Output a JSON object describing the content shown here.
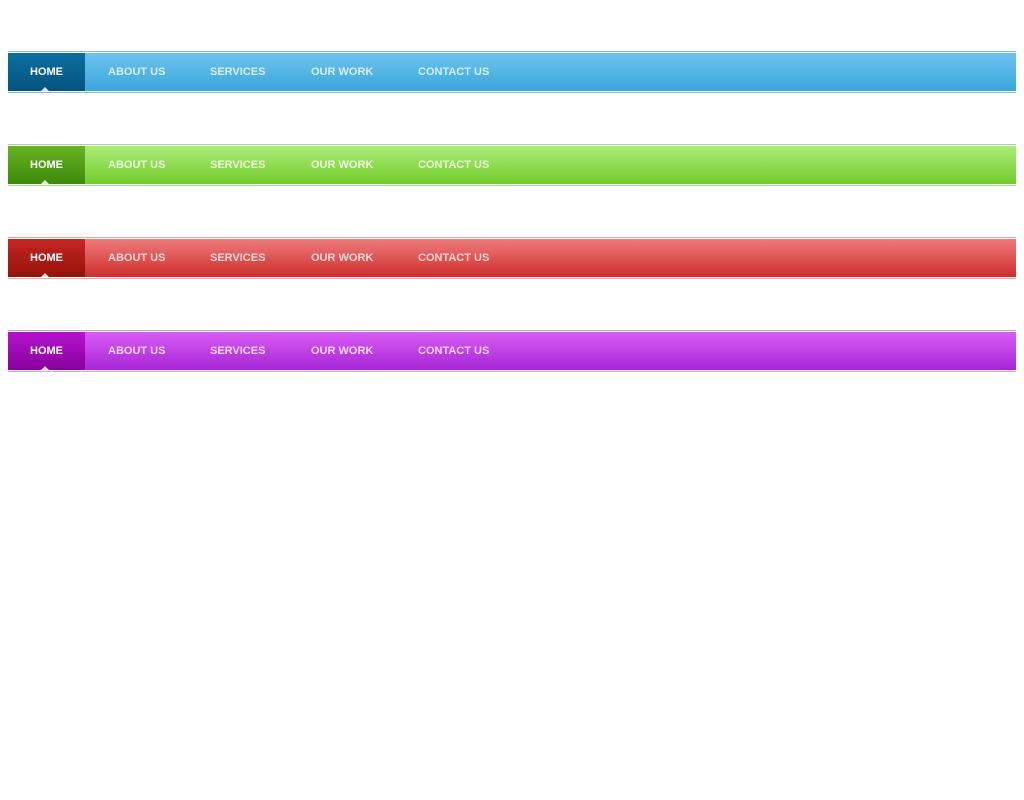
{
  "menus": [
    {
      "theme": "blue",
      "accent": "#3aa6dd",
      "active_color": "#04547f",
      "items": [
        {
          "label": "HOME",
          "active": true
        },
        {
          "label": "ABOUT US",
          "active": false
        },
        {
          "label": "SERVICES",
          "active": false
        },
        {
          "label": "OUR WORK",
          "active": false
        },
        {
          "label": "CONTACT US",
          "active": false
        }
      ]
    },
    {
      "theme": "green",
      "accent": "#72cc2a",
      "active_color": "#3f8a0c",
      "items": [
        {
          "label": "HOME",
          "active": true
        },
        {
          "label": "ABOUT US",
          "active": false
        },
        {
          "label": "SERVICES",
          "active": false
        },
        {
          "label": "OUR WORK",
          "active": false
        },
        {
          "label": "CONTACT US",
          "active": false
        }
      ]
    },
    {
      "theme": "red",
      "accent": "#cf2c2c",
      "active_color": "#961208",
      "items": [
        {
          "label": "HOME",
          "active": true
        },
        {
          "label": "ABOUT US",
          "active": false
        },
        {
          "label": "SERVICES",
          "active": false
        },
        {
          "label": "OUR WORK",
          "active": false
        },
        {
          "label": "CONTACT US",
          "active": false
        }
      ]
    },
    {
      "theme": "purple",
      "accent": "#a626d6",
      "active_color": "#86009c",
      "items": [
        {
          "label": "HOME",
          "active": true
        },
        {
          "label": "ABOUT US",
          "active": false
        },
        {
          "label": "SERVICES",
          "active": false
        },
        {
          "label": "OUR WORK",
          "active": false
        },
        {
          "label": "CONTACT US",
          "active": false
        }
      ]
    }
  ]
}
